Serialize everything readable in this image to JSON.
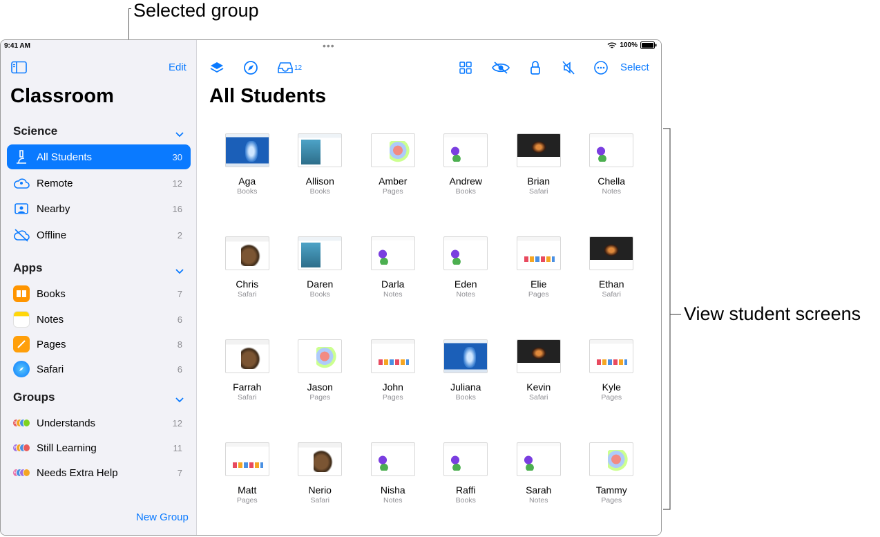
{
  "callouts": {
    "selected_group": "Selected group",
    "view_screens": "View student screens"
  },
  "status": {
    "time": "9:41 AM",
    "battery": "100%"
  },
  "sidebar": {
    "edit": "Edit",
    "title": "Classroom",
    "sections": [
      {
        "title": "Science",
        "items": [
          {
            "label": "All Students",
            "count": "30",
            "icon": "microscope-icon",
            "selected": true
          },
          {
            "label": "Remote",
            "count": "12",
            "icon": "cloud-person-icon"
          },
          {
            "label": "Nearby",
            "count": "16",
            "icon": "person-rectangle-icon"
          },
          {
            "label": "Offline",
            "count": "2",
            "icon": "cloud-slash-icon"
          }
        ]
      },
      {
        "title": "Apps",
        "items": [
          {
            "label": "Books",
            "count": "7",
            "icon": "books-app-icon",
            "color": "#ff9500"
          },
          {
            "label": "Notes",
            "count": "6",
            "icon": "notes-app-icon",
            "color": "#ffd60a"
          },
          {
            "label": "Pages",
            "count": "8",
            "icon": "pages-app-icon",
            "color": "#ff9f0a"
          },
          {
            "label": "Safari",
            "count": "6",
            "icon": "safari-app-icon",
            "color": "#1e90ff"
          }
        ]
      },
      {
        "title": "Groups",
        "items": [
          {
            "label": "Understands",
            "count": "12",
            "badge": "SC"
          },
          {
            "label": "Still Learning",
            "count": "11",
            "badge": "MR"
          },
          {
            "label": "Needs Extra Help",
            "count": "7",
            "badge": "EO"
          }
        ]
      }
    ],
    "new_group": "New Group"
  },
  "toolbar": {
    "inbox_count": "12",
    "select": "Select"
  },
  "main": {
    "title": "All Students"
  },
  "students": [
    {
      "name": "Aga",
      "app": "Books",
      "thumb": "books"
    },
    {
      "name": "Allison",
      "app": "Books",
      "thumb": "fish"
    },
    {
      "name": "Amber",
      "app": "Pages",
      "thumb": "map"
    },
    {
      "name": "Andrew",
      "app": "Books",
      "thumb": "notes"
    },
    {
      "name": "Brian",
      "app": "Safari",
      "thumb": "dark"
    },
    {
      "name": "Chella",
      "app": "Notes",
      "thumb": "notes"
    },
    {
      "name": "Chris",
      "app": "Safari",
      "thumb": "safari"
    },
    {
      "name": "Daren",
      "app": "Books",
      "thumb": "fish"
    },
    {
      "name": "Darla",
      "app": "Notes",
      "thumb": "notes"
    },
    {
      "name": "Eden",
      "app": "Notes",
      "thumb": "notes"
    },
    {
      "name": "Elie",
      "app": "Pages",
      "thumb": "pages"
    },
    {
      "name": "Ethan",
      "app": "Safari",
      "thumb": "dark"
    },
    {
      "name": "Farrah",
      "app": "Safari",
      "thumb": "safari"
    },
    {
      "name": "Jason",
      "app": "Pages",
      "thumb": "map"
    },
    {
      "name": "John",
      "app": "Pages",
      "thumb": "pages"
    },
    {
      "name": "Juliana",
      "app": "Books",
      "thumb": "books"
    },
    {
      "name": "Kevin",
      "app": "Safari",
      "thumb": "dark"
    },
    {
      "name": "Kyle",
      "app": "Pages",
      "thumb": "pages"
    },
    {
      "name": "Matt",
      "app": "Pages",
      "thumb": "pages"
    },
    {
      "name": "Nerio",
      "app": "Safari",
      "thumb": "safari"
    },
    {
      "name": "Nisha",
      "app": "Notes",
      "thumb": "notes"
    },
    {
      "name": "Raffi",
      "app": "Books",
      "thumb": "notes"
    },
    {
      "name": "Sarah",
      "app": "Notes",
      "thumb": "notes"
    },
    {
      "name": "Tammy",
      "app": "Pages",
      "thumb": "map"
    }
  ]
}
